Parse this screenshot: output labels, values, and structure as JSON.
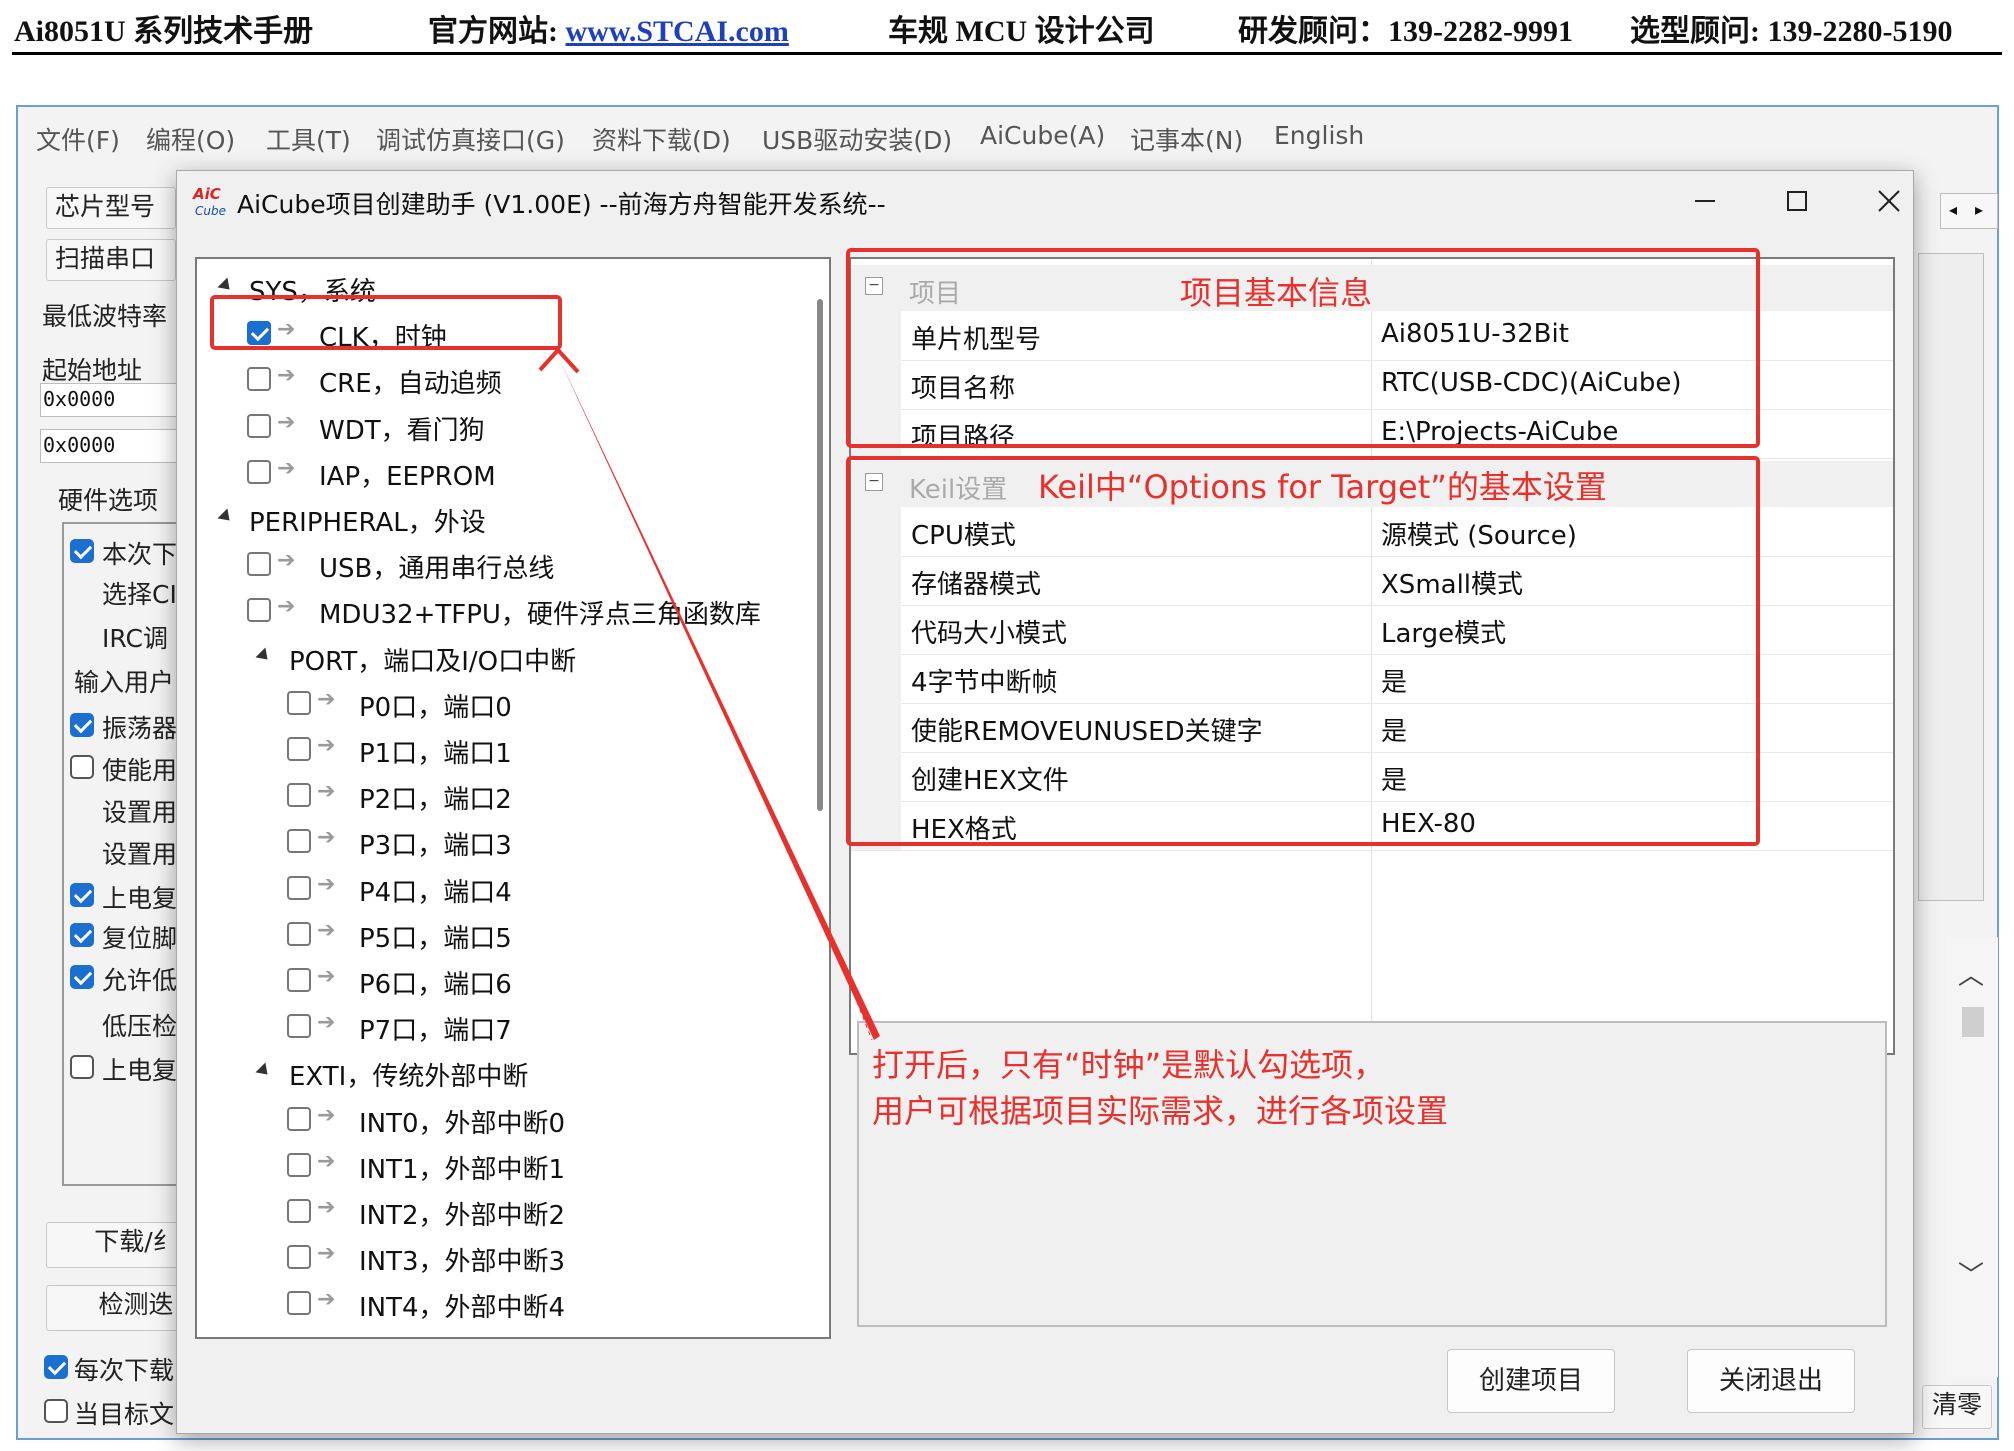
{
  "doc_header": {
    "manual": "Ai8051U 系列技术手册",
    "site_label": "官方网站: ",
    "site_url": "www.STCAI.com",
    "company": "车规 MCU 设计公司",
    "rd_advisor": "研发顾问：139-2282-9991",
    "selection_advisor": "选型顾问: 139-2280-5190"
  },
  "menubar": [
    "文件(F)",
    "编程(O)",
    "工具(T)",
    "调试仿真接口(G)",
    "资料下载(D)",
    "USB驱动安装(D)",
    "AiCube(A)",
    "记事本(N)",
    "English"
  ],
  "left_panel": {
    "chip_button": "芯片型号",
    "scan_button": "扫描串口",
    "min_baud": "最低波特率",
    "start_addr": "起始地址",
    "addr1": "0x0000",
    "addr2": "0x0000",
    "hw_options": "硬件选项",
    "options": [
      {
        "label": "本次下",
        "checked": true
      },
      {
        "label": "选择CI",
        "checked": null
      },
      {
        "label": "IRC调",
        "checked": null
      },
      {
        "label": "输入用户",
        "checked": null
      },
      {
        "label": "振荡器",
        "checked": true
      },
      {
        "label": "使能用",
        "checked": false
      },
      {
        "label": "设置用",
        "checked": null
      },
      {
        "label": "设置用",
        "checked": null
      },
      {
        "label": "上电复",
        "checked": true
      },
      {
        "label": "复位脚",
        "checked": true
      },
      {
        "label": "允许低",
        "checked": true
      },
      {
        "label": "低压检",
        "checked": null
      },
      {
        "label": "上电复",
        "checked": false
      }
    ],
    "download_button": "下载/纟",
    "detect_button": "检测迭",
    "every_download": "每次下载",
    "current_target": "当目标文"
  },
  "right_partial": {
    "clear_button": "清零"
  },
  "dialog": {
    "title": "AiCube项目创建助手 (V1.00E) --前海方舟智能开发系统--",
    "logo_text": "AiC",
    "tree": [
      {
        "level": 0,
        "type": "group",
        "label": "SYS，系统"
      },
      {
        "level": 1,
        "type": "item",
        "label": "CLK，时钟",
        "checked": true
      },
      {
        "level": 1,
        "type": "item",
        "label": "CRE，自动追频",
        "checked": false
      },
      {
        "level": 1,
        "type": "item",
        "label": "WDT，看门狗",
        "checked": false
      },
      {
        "level": 1,
        "type": "item",
        "label": "IAP，EEPROM",
        "checked": false
      },
      {
        "level": 0,
        "type": "group",
        "label": "PERIPHERAL，外设"
      },
      {
        "level": 1,
        "type": "item",
        "label": "USB，通用串行总线",
        "checked": false
      },
      {
        "level": 1,
        "type": "item",
        "label": "MDU32+TFPU，硬件浮点三角函数库",
        "checked": false
      },
      {
        "level": 1,
        "type": "group",
        "label": "PORT，端口及I/O口中断"
      },
      {
        "level": 2,
        "type": "item",
        "label": "P0口，端口0",
        "checked": false
      },
      {
        "level": 2,
        "type": "item",
        "label": "P1口，端口1",
        "checked": false
      },
      {
        "level": 2,
        "type": "item",
        "label": "P2口，端口2",
        "checked": false
      },
      {
        "level": 2,
        "type": "item",
        "label": "P3口，端口3",
        "checked": false
      },
      {
        "level": 2,
        "type": "item",
        "label": "P4口，端口4",
        "checked": false
      },
      {
        "level": 2,
        "type": "item",
        "label": "P5口，端口5",
        "checked": false
      },
      {
        "level": 2,
        "type": "item",
        "label": "P6口，端口6",
        "checked": false
      },
      {
        "level": 2,
        "type": "item",
        "label": "P7口，端口7",
        "checked": false
      },
      {
        "level": 1,
        "type": "group",
        "label": "EXTI，传统外部中断"
      },
      {
        "level": 2,
        "type": "item",
        "label": "INT0，外部中断0",
        "checked": false
      },
      {
        "level": 2,
        "type": "item",
        "label": "INT1，外部中断1",
        "checked": false
      },
      {
        "level": 2,
        "type": "item",
        "label": "INT2，外部中断2",
        "checked": false
      },
      {
        "level": 2,
        "type": "item",
        "label": "INT3，外部中断3",
        "checked": false
      },
      {
        "level": 2,
        "type": "item",
        "label": "INT4，外部中断4",
        "checked": false
      }
    ],
    "project_category": "项目",
    "project_props": [
      {
        "key": "单片机型号",
        "value": "Ai8051U-32Bit"
      },
      {
        "key": "项目名称",
        "value": "RTC(USB-CDC)(AiCube)"
      },
      {
        "key": "项目路径",
        "value": "E:\\Projects-AiCube"
      }
    ],
    "keil_category": "Keil设置",
    "keil_props": [
      {
        "key": "CPU模式",
        "value": "源模式 (Source)"
      },
      {
        "key": "存储器模式",
        "value": "XSmall模式"
      },
      {
        "key": "代码大小模式",
        "value": "Large模式"
      },
      {
        "key": "4字节中断帧",
        "value": "是"
      },
      {
        "key": "使能REMOVEUNUSED关键字",
        "value": "是"
      },
      {
        "key": "创建HEX文件",
        "value": "是"
      },
      {
        "key": "HEX格式",
        "value": "HEX-80"
      }
    ],
    "create_button": "创建项目",
    "close_button": "关闭退出"
  },
  "annotations": {
    "project_info": "项目基本信息",
    "keil_info": "Keil中“Options for Target”的基本设置",
    "note_line1": "打开后，只有“时钟”是默认勾选项，",
    "note_line2": "用户可根据项目实际需求，进行各项设置"
  },
  "colors": {
    "annotation_red": "#e8302c",
    "checkbox_blue": "#1a6fd0",
    "window_border": "#6aa0d4"
  }
}
